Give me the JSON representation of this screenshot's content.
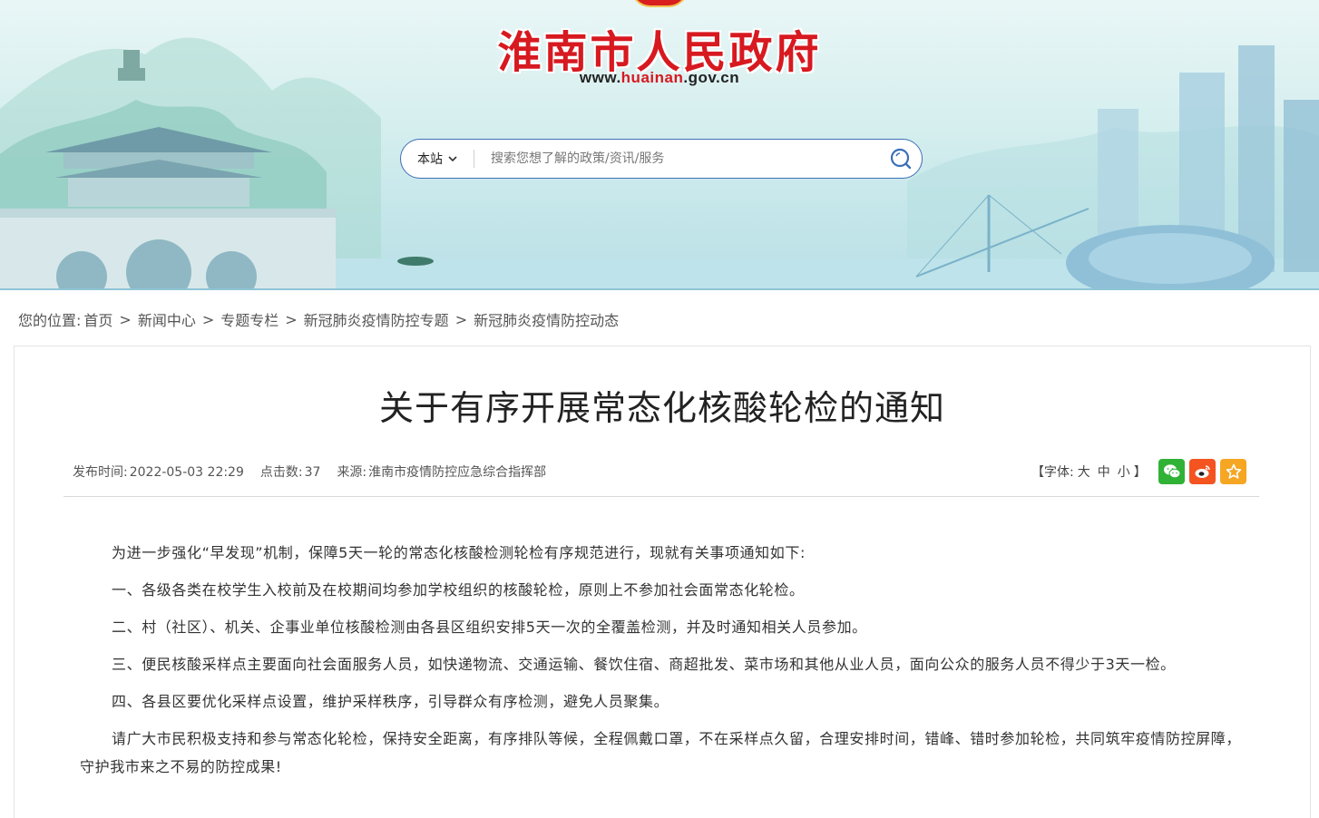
{
  "header": {
    "site_title": "淮南市人民政府",
    "url_prefix": "www.",
    "url_domain": "huainan",
    "url_suffix": ".gov.cn",
    "colors": {
      "title_red": "#d71920",
      "search_border": "#3c6fb6",
      "sky": "#d5eeee"
    }
  },
  "search": {
    "scope_label": "本站",
    "placeholder": "搜索您想了解的政策/资讯/服务",
    "search_icon": "magnifier-icon"
  },
  "breadcrumb": {
    "prefix": "您的位置:",
    "items": [
      "首页",
      "新闻中心",
      "专题专栏",
      "新冠肺炎疫情防控专题",
      "新冠肺炎疫情防控动态"
    ],
    "separator": ">"
  },
  "article": {
    "title": "关于有序开展常态化核酸轮检的通知",
    "meta": {
      "publish_label": "发布时间:",
      "publish_time": "2022-05-03 22:29",
      "clicks_label": "点击数:",
      "clicks": "37",
      "source_label": "来源:",
      "source": "淮南市疫情防控应急综合指挥部"
    },
    "font_size": {
      "open": "【字体:",
      "large": "大",
      "medium": "中",
      "small": "小",
      "close": "】"
    },
    "share": {
      "icons": [
        "wechat-icon",
        "weibo-icon",
        "favorite-star-icon"
      ]
    },
    "paragraphs": [
      "为进一步强化“早发现”机制，保障5天一轮的常态化核酸检测轮检有序规范进行，现就有关事项通知如下:",
      "一、各级各类在校学生入校前及在校期间均参加学校组织的核酸轮检，原则上不参加社会面常态化轮检。",
      "二、村（社区）、机关、企事业单位核酸检测由各县区组织安排5天一次的全覆盖检测，并及时通知相关人员参加。",
      "三、便民核酸采样点主要面向社会面服务人员，如快递物流、交通运输、餐饮住宿、商超批发、菜市场和其他从业人员，面向公众的服务人员不得少于3天一检。",
      "四、各县区要优化采样点设置，维护采样秩序，引导群众有序检测，避免人员聚集。",
      "请广大市民积极支持和参与常态化轮检，保持安全距离，有序排队等候，全程佩戴口罩，不在采样点久留，合理安排时间，错峰、错时参加轮检，共同筑牢疫情防控屏障，守护我市来之不易的防控成果!"
    ]
  }
}
